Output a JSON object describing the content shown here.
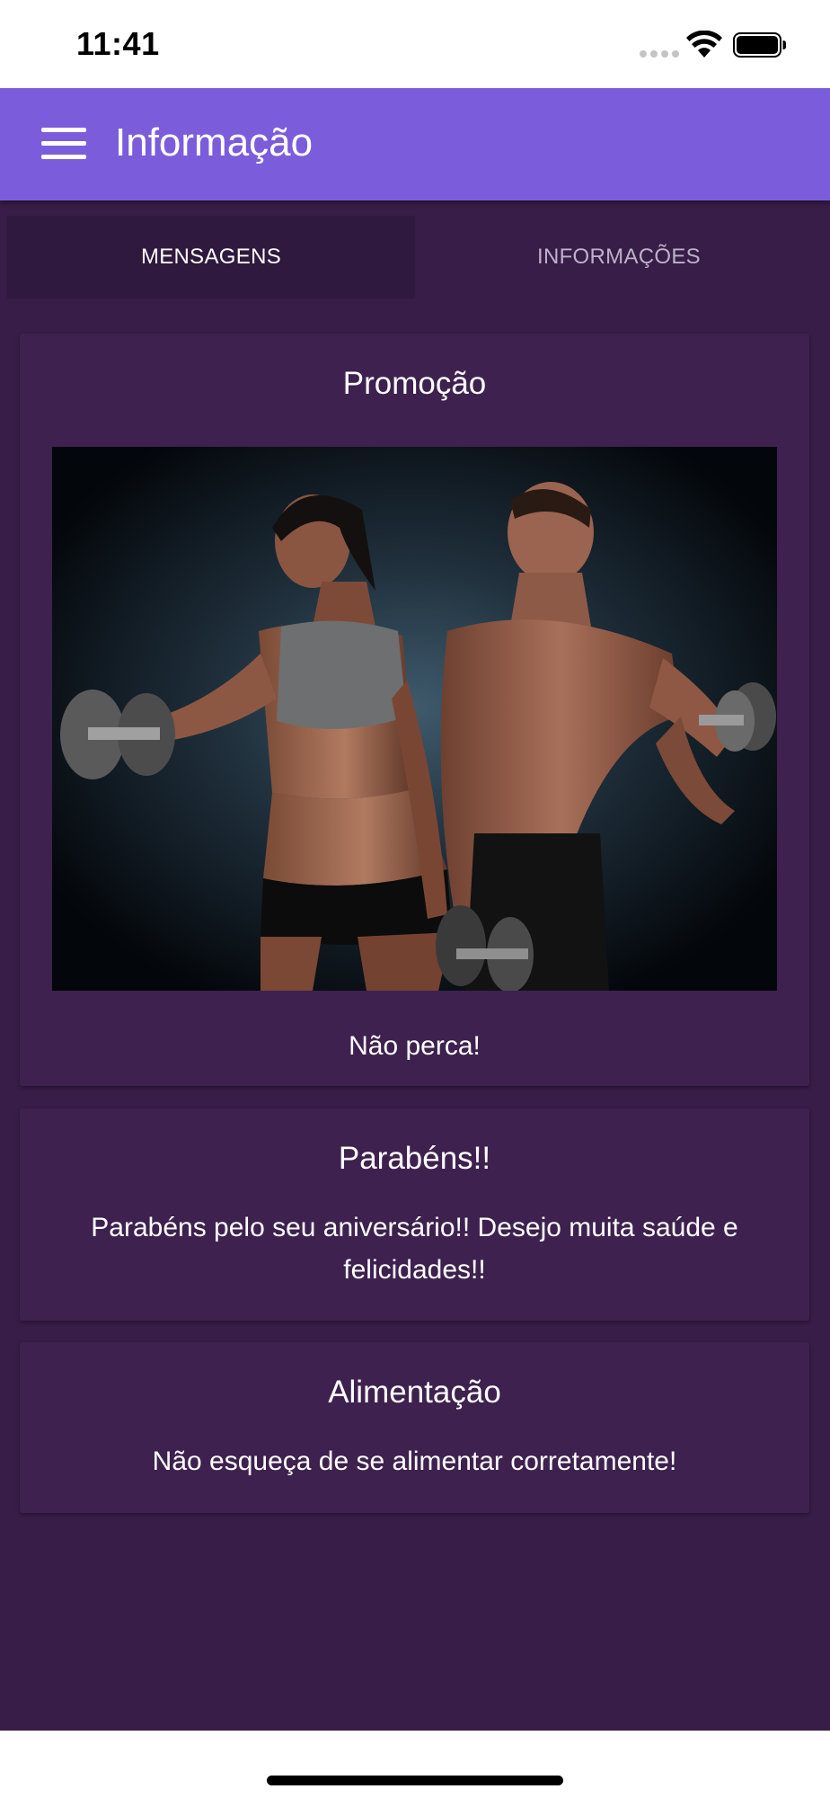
{
  "status_bar": {
    "time": "11:41"
  },
  "app_bar": {
    "title": "Informação",
    "menu_icon": "hamburger-menu-icon"
  },
  "tabs": [
    {
      "label": "MENSAGENS",
      "active": true
    },
    {
      "label": "INFORMAÇÕES",
      "active": false
    }
  ],
  "cards": [
    {
      "title": "Promoção",
      "text": "Não perca!",
      "image": "fitness-couple-dumbbells"
    },
    {
      "title": "Parabéns!!",
      "text": "Parabéns pelo seu aniversário!! Desejo muita saúde e felicidades!!"
    },
    {
      "title": "Alimentação",
      "text": "Não esqueça de se alimentar corretamente!"
    }
  ],
  "colors": {
    "app_bar": "#7b5ddb",
    "background": "#371d47",
    "card": "#3e214f",
    "tab_active": "#2f193e"
  }
}
